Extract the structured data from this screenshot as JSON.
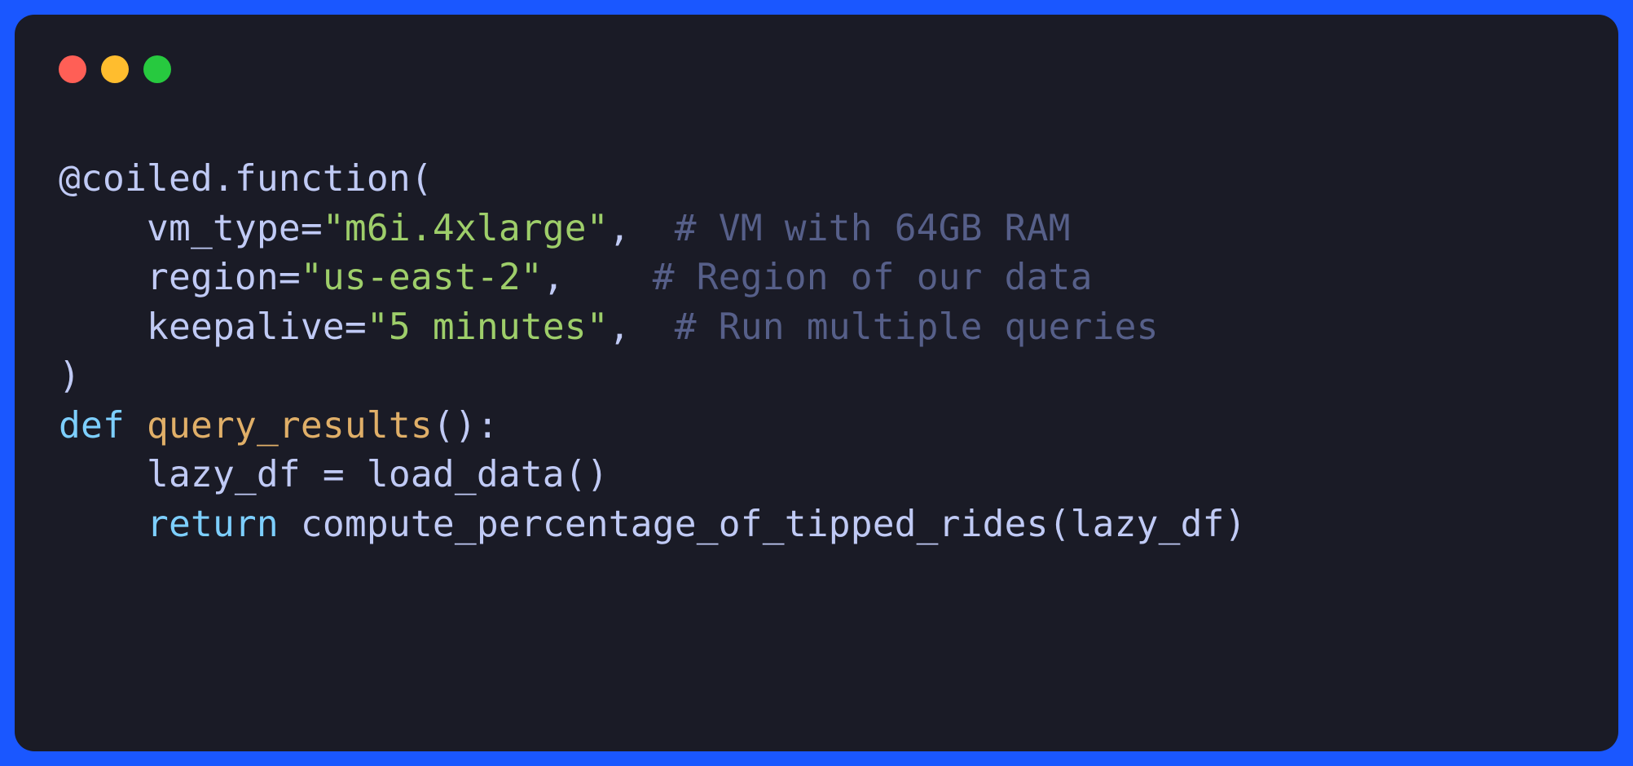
{
  "titlebar": {
    "dots": [
      "close",
      "minimize",
      "zoom"
    ]
  },
  "code": {
    "line1": {
      "decorator_prefix": "@coiled.function("
    },
    "line2": {
      "indent": "    ",
      "param": "vm_type=",
      "string": "\"m6i.4xlarge\"",
      "comma_pad": ",  ",
      "comment": "# VM with 64GB RAM"
    },
    "line3": {
      "indent": "    ",
      "param": "region=",
      "string": "\"us-east-2\"",
      "comma_pad": ",    ",
      "comment": "# Region of our data"
    },
    "line4": {
      "indent": "    ",
      "param": "keepalive=",
      "string": "\"5 minutes\"",
      "comma_pad": ",  ",
      "comment": "# Run multiple queries"
    },
    "line5": {
      "close": ")"
    },
    "line6": {
      "keyword": "def",
      "space": " ",
      "funcname": "query_results",
      "parens": "():"
    },
    "line7": {
      "indent": "    ",
      "body": "lazy_df = load_data()"
    },
    "line8": {
      "indent": "    ",
      "keyword": "return",
      "space": " ",
      "body": "compute_percentage_of_tipped_rides(lazy_df)"
    }
  }
}
